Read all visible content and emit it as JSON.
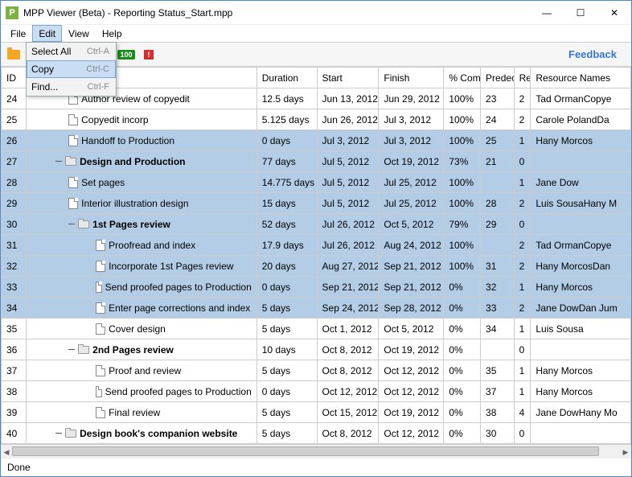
{
  "title": "MPP Viewer (Beta) - Reporting Status_Start.mpp",
  "menubar": [
    "File",
    "Edit",
    "View",
    "Help"
  ],
  "edit_menu": {
    "select_all": {
      "label": "Select All",
      "hotkey": "Ctrl-A"
    },
    "copy": {
      "label": "Copy",
      "hotkey": "Ctrl-C"
    },
    "find": {
      "label": "Find...",
      "hotkey": "Ctrl-F"
    }
  },
  "toolbar": {
    "green_badge": "100",
    "red_badge": "!",
    "feedback": "Feedback"
  },
  "columns": {
    "id": "ID",
    "name": "",
    "duration": "Duration",
    "start": "Start",
    "finish": "Finish",
    "pct": "% Compl",
    "pred": "Predec",
    "rc": "Re C",
    "resources": "Resource Names"
  },
  "rows": [
    {
      "id": "24",
      "indent": 2,
      "icon": "doc",
      "bold": false,
      "sel": false,
      "name": "Author review of copyedit",
      "duration": "12.5 days",
      "start": "Jun 13, 2012",
      "finish": "Jun 29, 2012",
      "pct": "100%",
      "pred": "23",
      "rc": "2",
      "res": "Tad OrmanCopye"
    },
    {
      "id": "25",
      "indent": 2,
      "icon": "doc",
      "bold": false,
      "sel": false,
      "name": "Copyedit incorp",
      "duration": "5.125 days",
      "start": "Jun 26, 2012",
      "finish": "Jul 3, 2012",
      "pct": "100%",
      "pred": "24",
      "rc": "2",
      "res": "Carole PolandDa"
    },
    {
      "id": "26",
      "indent": 2,
      "icon": "doc",
      "bold": false,
      "sel": true,
      "name": "Handoff to Production",
      "duration": "0 days",
      "start": "Jul 3, 2012",
      "finish": "Jul 3, 2012",
      "pct": "100%",
      "pred": "25",
      "rc": "1",
      "res": "Hany Morcos"
    },
    {
      "id": "27",
      "indent": 1,
      "icon": "folder",
      "exp": true,
      "bold": true,
      "sel": true,
      "name": "Design and Production",
      "duration": "77 days",
      "start": "Jul 5, 2012",
      "finish": "Oct 19, 2012",
      "pct": "73%",
      "pred": "21",
      "rc": "0",
      "res": ""
    },
    {
      "id": "28",
      "indent": 2,
      "icon": "doc",
      "bold": false,
      "sel": true,
      "name": "Set pages",
      "duration": "14.775 days",
      "start": "Jul 5, 2012",
      "finish": "Jul 25, 2012",
      "pct": "100%",
      "pred": "",
      "rc": "1",
      "res": "Jane Dow"
    },
    {
      "id": "29",
      "indent": 2,
      "icon": "doc",
      "bold": false,
      "sel": true,
      "name": "Interior illustration design",
      "duration": "15 days",
      "start": "Jul 5, 2012",
      "finish": "Jul 25, 2012",
      "pct": "100%",
      "pred": "28",
      "rc": "2",
      "res": "Luis SousaHany M"
    },
    {
      "id": "30",
      "indent": 2,
      "icon": "folder",
      "exp": true,
      "bold": true,
      "sel": true,
      "name": "1st Pages review",
      "duration": "52 days",
      "start": "Jul 26, 2012",
      "finish": "Oct 5, 2012",
      "pct": "79%",
      "pred": "29",
      "rc": "0",
      "res": ""
    },
    {
      "id": "31",
      "indent": 3,
      "icon": "doc",
      "bold": false,
      "sel": true,
      "name": "Proofread and index",
      "duration": "17.9 days",
      "start": "Jul 26, 2012",
      "finish": "Aug 24, 2012",
      "pct": "100%",
      "pred": "",
      "rc": "2",
      "res": "Tad OrmanCopye"
    },
    {
      "id": "32",
      "indent": 3,
      "icon": "doc",
      "bold": false,
      "sel": true,
      "name": "Incorporate 1st Pages review",
      "duration": "20 days",
      "start": "Aug 27, 2012",
      "finish": "Sep 21, 2012",
      "pct": "100%",
      "pred": "31",
      "rc": "2",
      "res": "Hany MorcosDan"
    },
    {
      "id": "33",
      "indent": 3,
      "icon": "doc",
      "bold": false,
      "sel": true,
      "name": "Send proofed pages to Production",
      "duration": "0 days",
      "start": "Sep 21, 2012",
      "finish": "Sep 21, 2012",
      "pct": "0%",
      "pred": "32",
      "rc": "1",
      "res": "Hany Morcos"
    },
    {
      "id": "34",
      "indent": 3,
      "icon": "doc",
      "bold": false,
      "sel": true,
      "name": "Enter page corrections and index",
      "duration": "5 days",
      "start": "Sep 24, 2012",
      "finish": "Sep 28, 2012",
      "pct": "0%",
      "pred": "33",
      "rc": "2",
      "res": "Jane DowDan Jum"
    },
    {
      "id": "35",
      "indent": 3,
      "icon": "doc",
      "bold": false,
      "sel": false,
      "name": "Cover design",
      "duration": "5 days",
      "start": "Oct 1, 2012",
      "finish": "Oct 5, 2012",
      "pct": "0%",
      "pred": "34",
      "rc": "1",
      "res": "Luis Sousa"
    },
    {
      "id": "36",
      "indent": 2,
      "icon": "folder",
      "exp": true,
      "bold": true,
      "sel": false,
      "name": "2nd Pages review",
      "duration": "10 days",
      "start": "Oct 8, 2012",
      "finish": "Oct 19, 2012",
      "pct": "0%",
      "pred": "",
      "rc": "0",
      "res": ""
    },
    {
      "id": "37",
      "indent": 3,
      "icon": "doc",
      "bold": false,
      "sel": false,
      "name": "Proof and review",
      "duration": "5 days",
      "start": "Oct 8, 2012",
      "finish": "Oct 12, 2012",
      "pct": "0%",
      "pred": "35",
      "rc": "1",
      "res": "Hany Morcos"
    },
    {
      "id": "38",
      "indent": 3,
      "icon": "doc",
      "bold": false,
      "sel": false,
      "name": "Send proofed pages to Production",
      "duration": "0 days",
      "start": "Oct 12, 2012",
      "finish": "Oct 12, 2012",
      "pct": "0%",
      "pred": "37",
      "rc": "1",
      "res": "Hany Morcos"
    },
    {
      "id": "39",
      "indent": 3,
      "icon": "doc",
      "bold": false,
      "sel": false,
      "name": "Final review",
      "duration": "5 days",
      "start": "Oct 15, 2012",
      "finish": "Oct 19, 2012",
      "pct": "0%",
      "pred": "38",
      "rc": "4",
      "res": "Jane DowHany Mo"
    },
    {
      "id": "40",
      "indent": 1,
      "icon": "folder",
      "exp": true,
      "bold": true,
      "sel": false,
      "name": "Design book's companion website",
      "duration": "5 days",
      "start": "Oct 8, 2012",
      "finish": "Oct 12, 2012",
      "pct": "0%",
      "pred": "30",
      "rc": "0",
      "res": ""
    }
  ],
  "status": "Done"
}
